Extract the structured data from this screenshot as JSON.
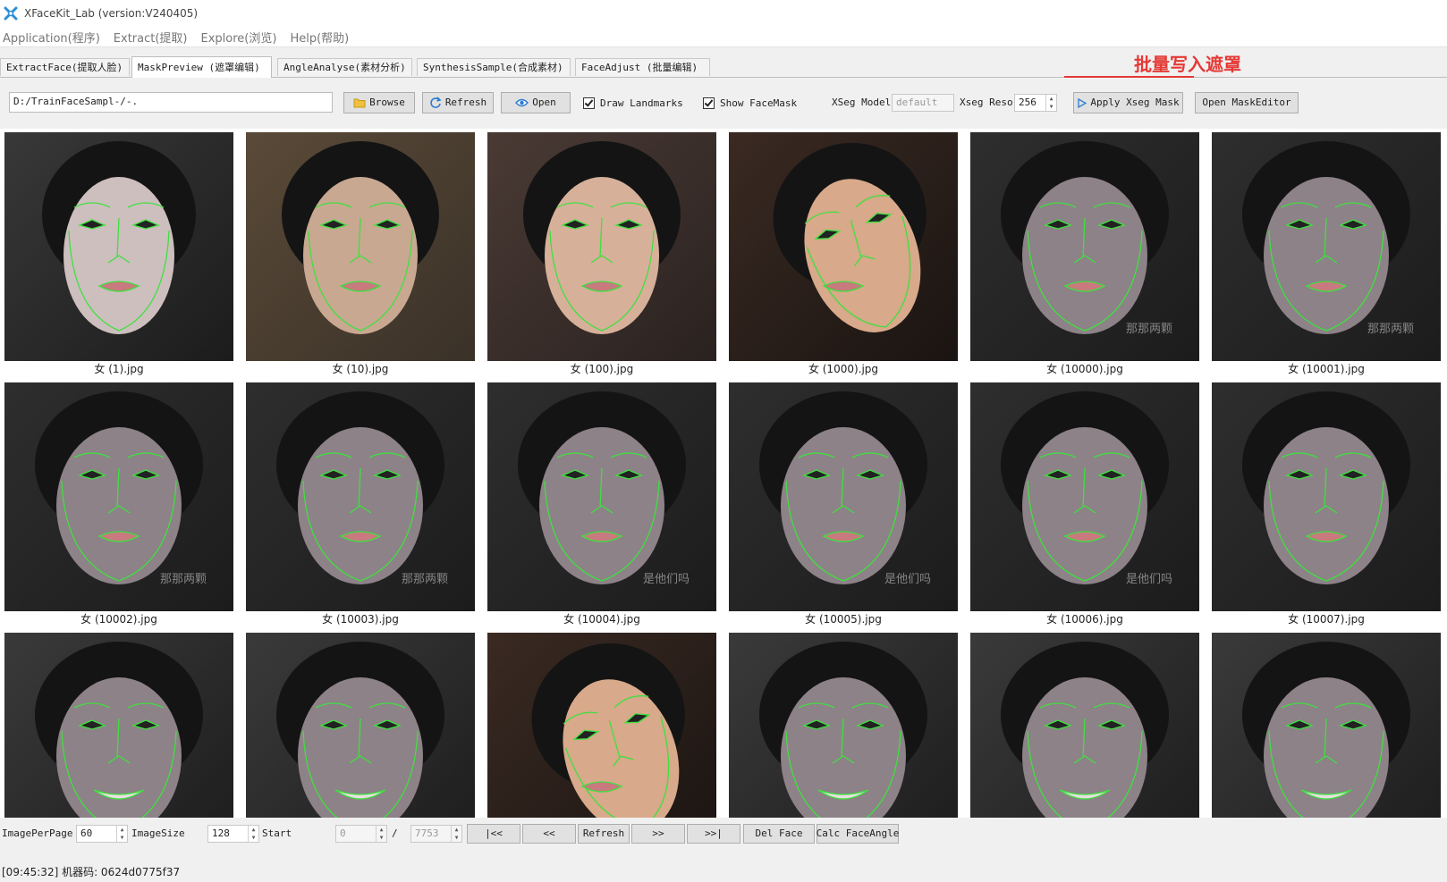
{
  "window": {
    "title": "XFaceKit_Lab (version:V240405)"
  },
  "menu": [
    "Application(程序)",
    "Extract(提取)",
    "Explore(浏览)",
    "Help(帮助)"
  ],
  "tabs": [
    "ExtractFace(提取人脸)",
    "MaskPreview (遮罩编辑)",
    "AngleAnalyse(素材分析)",
    "SynthesisSample(合成素材)",
    "FaceAdjust (批量编辑)"
  ],
  "active_tab": 1,
  "toolbar": {
    "path_value": "D:/TrainFaceSampl-/-.",
    "browse_label": "Browse",
    "refresh_label": "Refresh",
    "open_label": "Open",
    "draw_landmarks_label": "Draw Landmarks",
    "draw_landmarks_checked": true,
    "show_facemask_label": "Show FaceMask",
    "show_facemask_checked": true,
    "xseg_model_label": "XSeg Model",
    "xseg_model_value": "default",
    "xseg_reso_label": "Xseg Reso",
    "xseg_reso_value": "256",
    "apply_xseg_label": "Apply Xseg Mask",
    "open_maskeditor_label": "Open  MaskEditor"
  },
  "annotation": {
    "text": "批量写入遮罩",
    "color": "#e53935"
  },
  "images": [
    {
      "name": "女 (1).jpg",
      "watermark": "",
      "variant": "a"
    },
    {
      "name": "女 (10).jpg",
      "watermark": "",
      "variant": "b"
    },
    {
      "name": "女 (100).jpg",
      "watermark": "",
      "variant": "c"
    },
    {
      "name": "女 (1000).jpg",
      "watermark": "",
      "variant": "d"
    },
    {
      "name": "女 (10000).jpg",
      "watermark": "那那两颗",
      "variant": "e"
    },
    {
      "name": "女 (10001).jpg",
      "watermark": "那那两颗",
      "variant": "e"
    },
    {
      "name": "女 (10002).jpg",
      "watermark": "那那两颗",
      "variant": "e"
    },
    {
      "name": "女 (10003).jpg",
      "watermark": "那那两颗",
      "variant": "e"
    },
    {
      "name": "女 (10004).jpg",
      "watermark": "是他们吗",
      "variant": "e"
    },
    {
      "name": "女 (10005).jpg",
      "watermark": "是他们吗",
      "variant": "e"
    },
    {
      "name": "女 (10006).jpg",
      "watermark": "是他们吗",
      "variant": "e"
    },
    {
      "name": "女 (10007).jpg",
      "watermark": "",
      "variant": "e"
    },
    {
      "name": "",
      "watermark": "",
      "variant": "f"
    },
    {
      "name": "",
      "watermark": "",
      "variant": "f"
    },
    {
      "name": "",
      "watermark": "",
      "variant": "d"
    },
    {
      "name": "",
      "watermark": "",
      "variant": "f"
    },
    {
      "name": "",
      "watermark": "",
      "variant": "f"
    },
    {
      "name": "",
      "watermark": "",
      "variant": "f"
    }
  ],
  "pager": {
    "image_per_page_label": "ImagePerPage",
    "image_per_page_value": "60",
    "image_size_label": "ImageSize",
    "image_size_value": "128",
    "start_label": "Start",
    "start_value": "0",
    "slash": "/",
    "total_value": "7753",
    "first_label": "|<<",
    "prev_label": "<<",
    "refresh_label": "Refresh",
    "next_label": ">>",
    "last_label": ">>|",
    "del_face_label": "Del Face",
    "calc_angle_label": "Calc FaceAngle"
  },
  "status": {
    "text": "[09:45:32] 机器码: 0624d0775f37"
  },
  "colors": {
    "landmark": "#3fe03f",
    "skin_cool": "#8a7f86",
    "skin_warm": "#d8a98a"
  }
}
